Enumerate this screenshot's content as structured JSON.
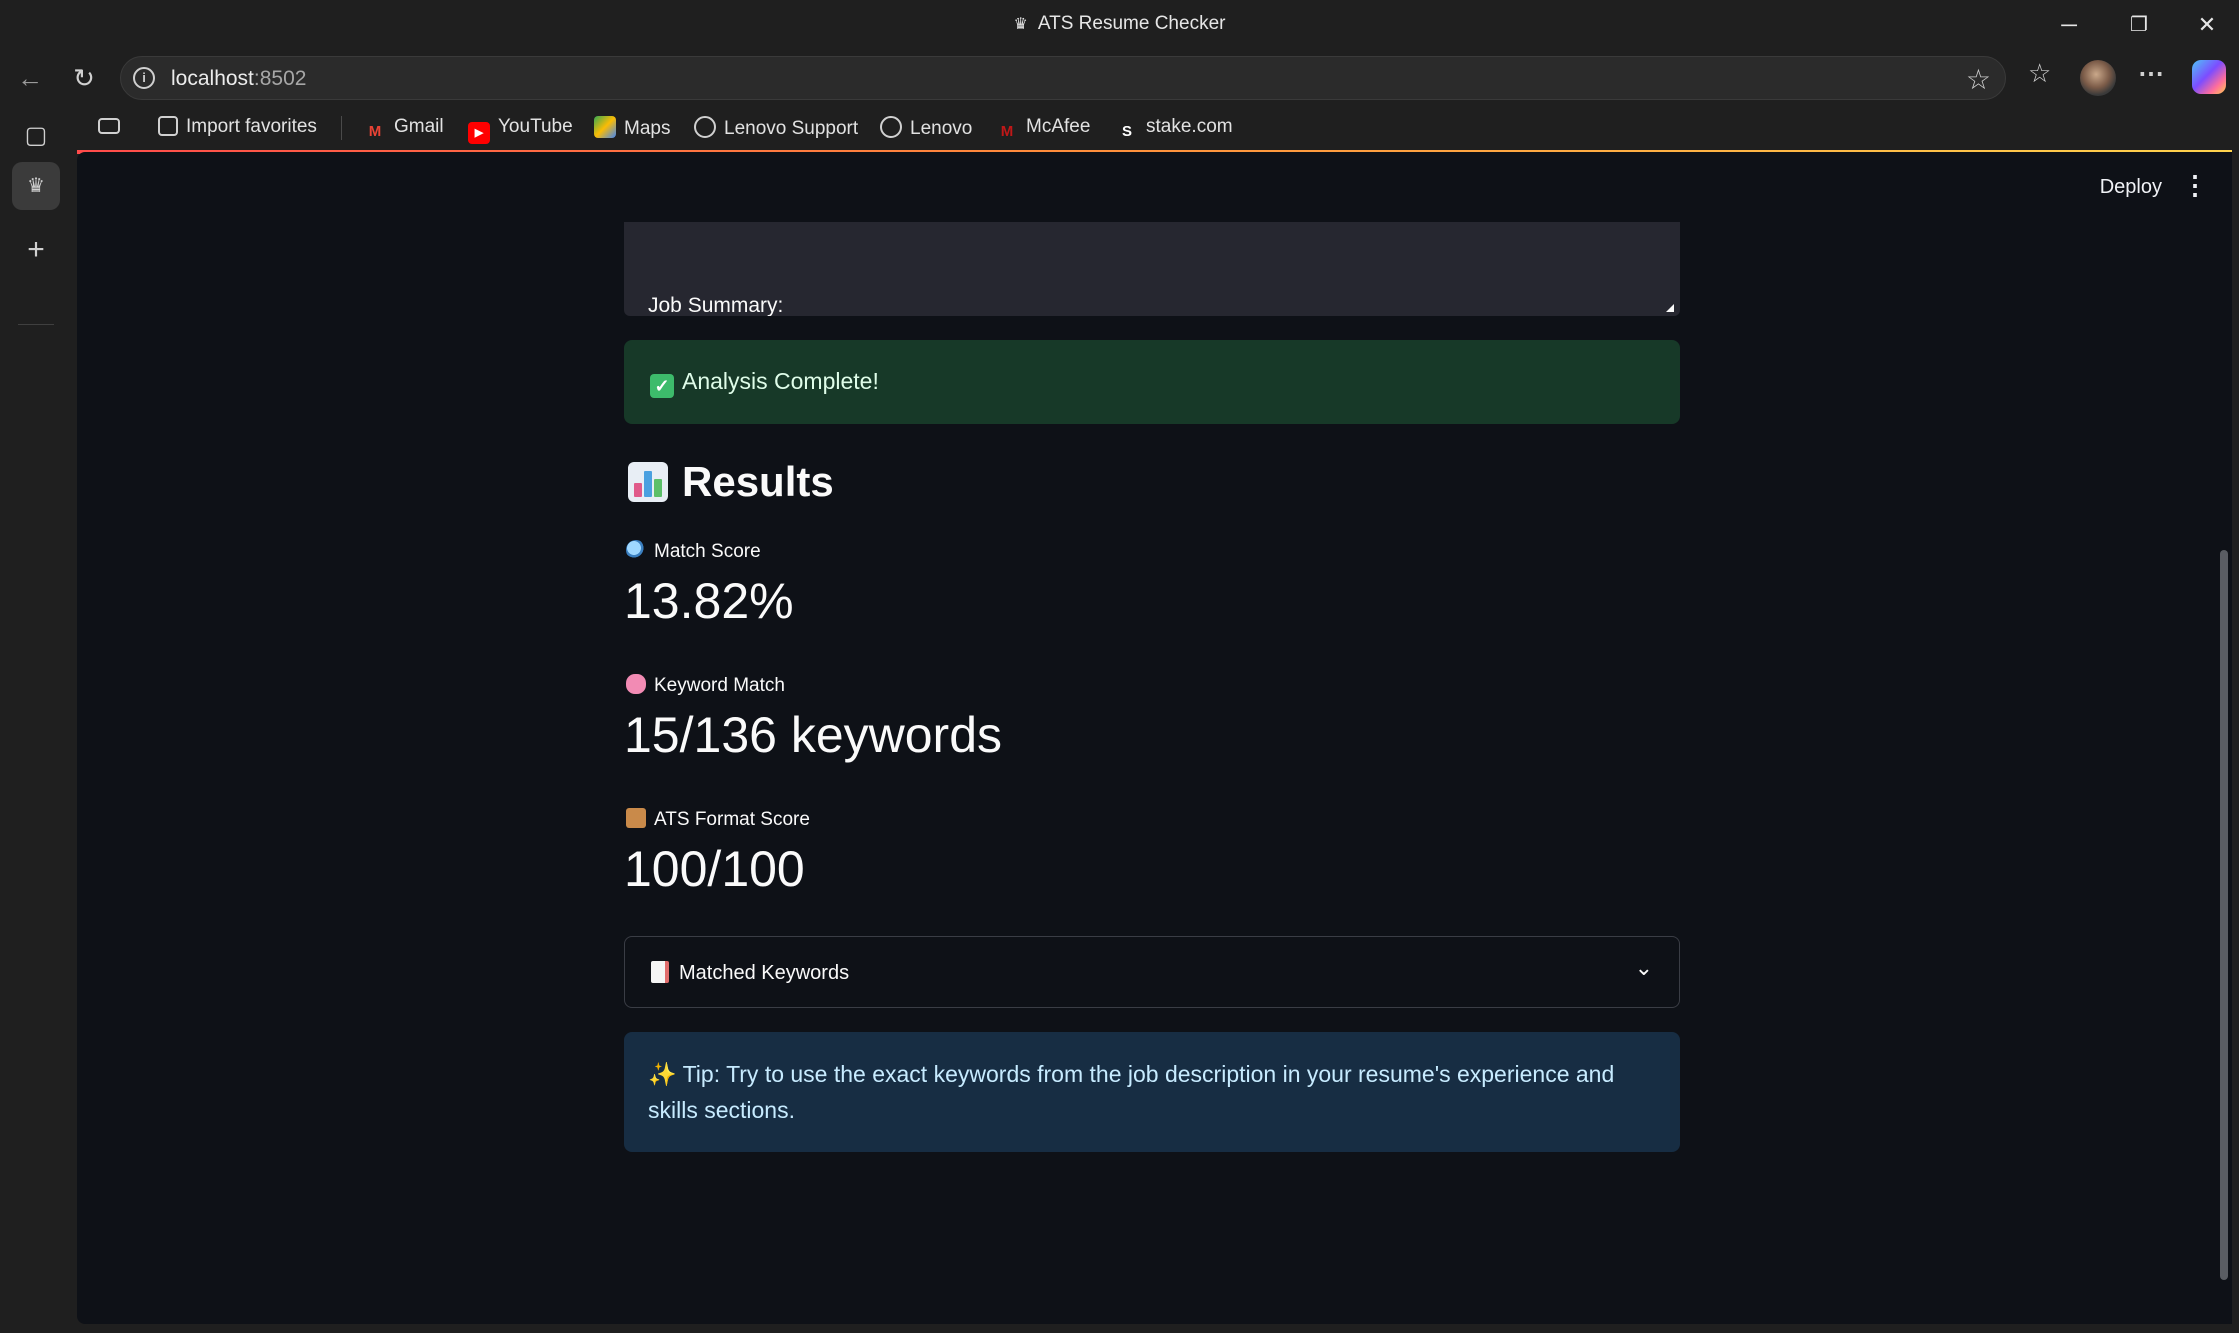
{
  "window": {
    "title": "ATS Resume Checker",
    "controls": {
      "minimize": "─",
      "restore": "❐",
      "close": "✕"
    }
  },
  "browser": {
    "url_host": "localhost",
    "url_port": ":8502",
    "bookmarks": [
      {
        "label": "Import favorites",
        "icon": "import-icon"
      },
      {
        "label": "Gmail",
        "icon": "gmail-icon"
      },
      {
        "label": "YouTube",
        "icon": "youtube-icon"
      },
      {
        "label": "Maps",
        "icon": "maps-icon"
      },
      {
        "label": "Lenovo Support",
        "icon": "globe-icon"
      },
      {
        "label": "Lenovo",
        "icon": "globe-icon"
      },
      {
        "label": "McAfee",
        "icon": "mcafee-icon"
      },
      {
        "label": "stake.com",
        "icon": "stake-icon"
      }
    ]
  },
  "app": {
    "toolbar": {
      "deploy_label": "Deploy"
    },
    "job_summary_text": "Job Summary:",
    "success_message": "Analysis Complete!",
    "results_heading": "Results",
    "metrics": [
      {
        "label": "Match Score",
        "value": "13.82%"
      },
      {
        "label": "Keyword Match",
        "value": "15/136 keywords"
      },
      {
        "label": "ATS Format Score",
        "value": "100/100"
      }
    ],
    "expander_label": "Matched Keywords",
    "tip_text": "✨ Tip: Try to use the exact keywords from the job description in your resume's experience and skills sections."
  },
  "colors": {
    "app_background": "#0e1117",
    "success_background": "#173928",
    "info_background": "#172d43",
    "text": "#fafafa"
  }
}
